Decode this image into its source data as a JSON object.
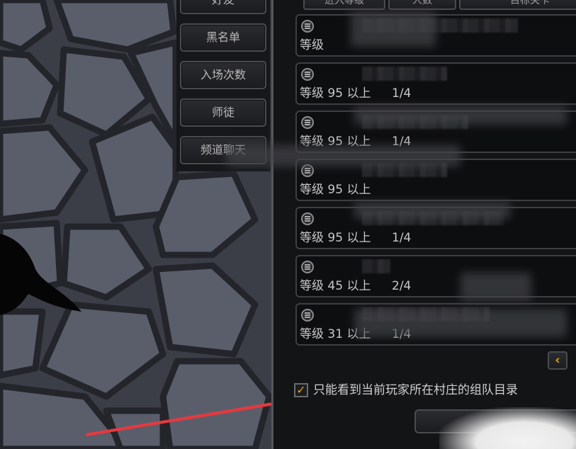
{
  "side_tabs": [
    {
      "label": "好友"
    },
    {
      "label": "黑名单"
    },
    {
      "label": "入场次数"
    },
    {
      "label": "师徒"
    },
    {
      "label": "频道聊天"
    }
  ],
  "column_headers": [
    {
      "label": "进入等级"
    },
    {
      "label": "人数"
    },
    {
      "label": "目标关卡"
    }
  ],
  "team_rows": [
    {
      "level": "等级",
      "count": ""
    },
    {
      "level": "等级 95 以上",
      "count": "1/4"
    },
    {
      "level": "等级 95 以上",
      "count": "1/4"
    },
    {
      "level": "等级 95 以上",
      "count": ""
    },
    {
      "level": "等级 95 以上",
      "count": "1/4"
    },
    {
      "level": "等级 45 以上",
      "count": "2/4"
    },
    {
      "level": "等级 31 以上",
      "count": "1/4"
    }
  ],
  "scroll_button": {
    "glyph": "‹"
  },
  "filter": {
    "checked_glyph": "✓",
    "label": "只能看到当前玩家所在村庄的组队目录"
  },
  "colors": {
    "accent": "#e0a21f",
    "arrow": "#e8383d",
    "panel_bg": "#131416"
  },
  "icons": {
    "row_icon": "team-icon",
    "scroll": "chevron-left-icon",
    "check": "check-icon"
  }
}
